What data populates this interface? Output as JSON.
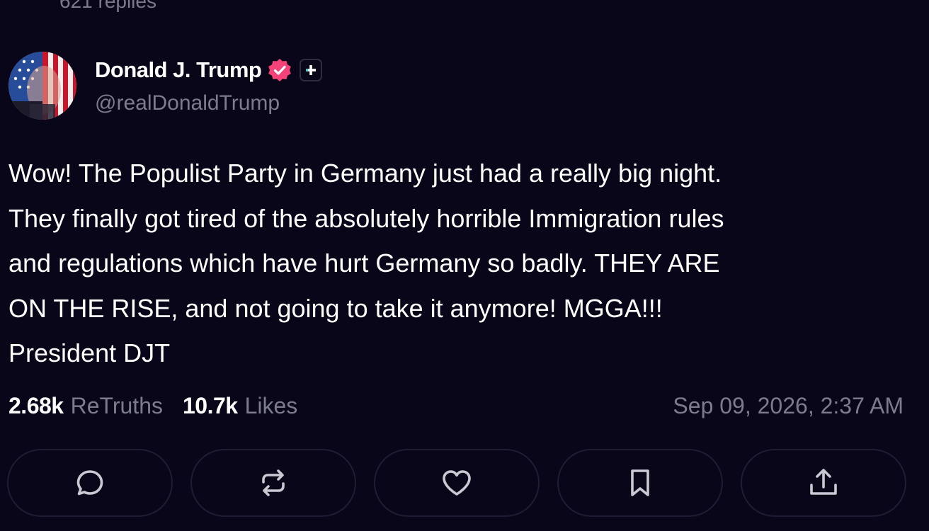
{
  "thread": {
    "replies_label": "621 replies"
  },
  "post": {
    "author": {
      "display_name": "Donald J. Trump",
      "handle": "@realDonaldTrump",
      "avatar_icon": "avatar-flag-portrait",
      "verified_icon": "verified-badge-icon",
      "verified_color": "#f5437a",
      "plus_icon": "plus-badge-icon"
    },
    "body_lines": [
      "Wow! The Populist Party in Germany just had a really big night.",
      "They finally got tired of the absolutely horrible Immigration rules",
      "and regulations which have hurt Germany so badly. THEY ARE",
      "ON THE RISE, and not going to take it anymore! MGGA!!!",
      "President DJT"
    ],
    "stats": {
      "retruths_count": "2.68k",
      "retruths_label": "ReTruths",
      "likes_count": "10.7k",
      "likes_label": "Likes"
    },
    "timestamp": "Sep 09, 2026, 2:37 AM"
  },
  "actions": [
    {
      "name": "reply-button",
      "icon": "reply-icon"
    },
    {
      "name": "retruth-button",
      "icon": "retruth-icon"
    },
    {
      "name": "like-button",
      "icon": "heart-icon"
    },
    {
      "name": "bookmark-button",
      "icon": "bookmark-icon"
    },
    {
      "name": "share-button",
      "icon": "share-icon"
    }
  ],
  "colors": {
    "background": "#080618",
    "muted_text": "#7c7c8d",
    "button_border": "#1f1d33"
  }
}
